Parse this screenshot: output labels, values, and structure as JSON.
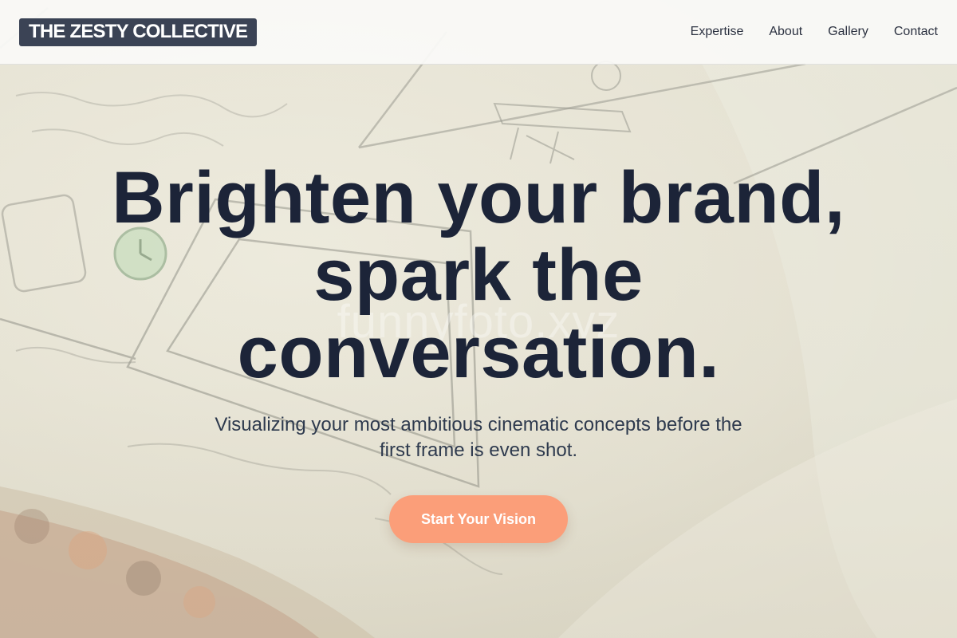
{
  "header": {
    "logo_text": "THE ZESTY COLLECTIVE",
    "nav": [
      {
        "label": "Expertise"
      },
      {
        "label": "About"
      },
      {
        "label": "Gallery"
      },
      {
        "label": "Contact"
      }
    ]
  },
  "hero": {
    "title_lines": [
      "Brighten your brand,",
      "spark the",
      "conversation."
    ],
    "subtitle_lines": [
      "Visualizing your most ambitious cinematic concepts before the",
      "first frame is even shot."
    ],
    "cta_label": "Start Your Vision",
    "watermark": "funnyfoto.xyz"
  },
  "colors": {
    "logo_bg": "#3b4355",
    "title": "#1c2438",
    "cta": "#fb9e79",
    "header_bg": "#fafaf8"
  }
}
